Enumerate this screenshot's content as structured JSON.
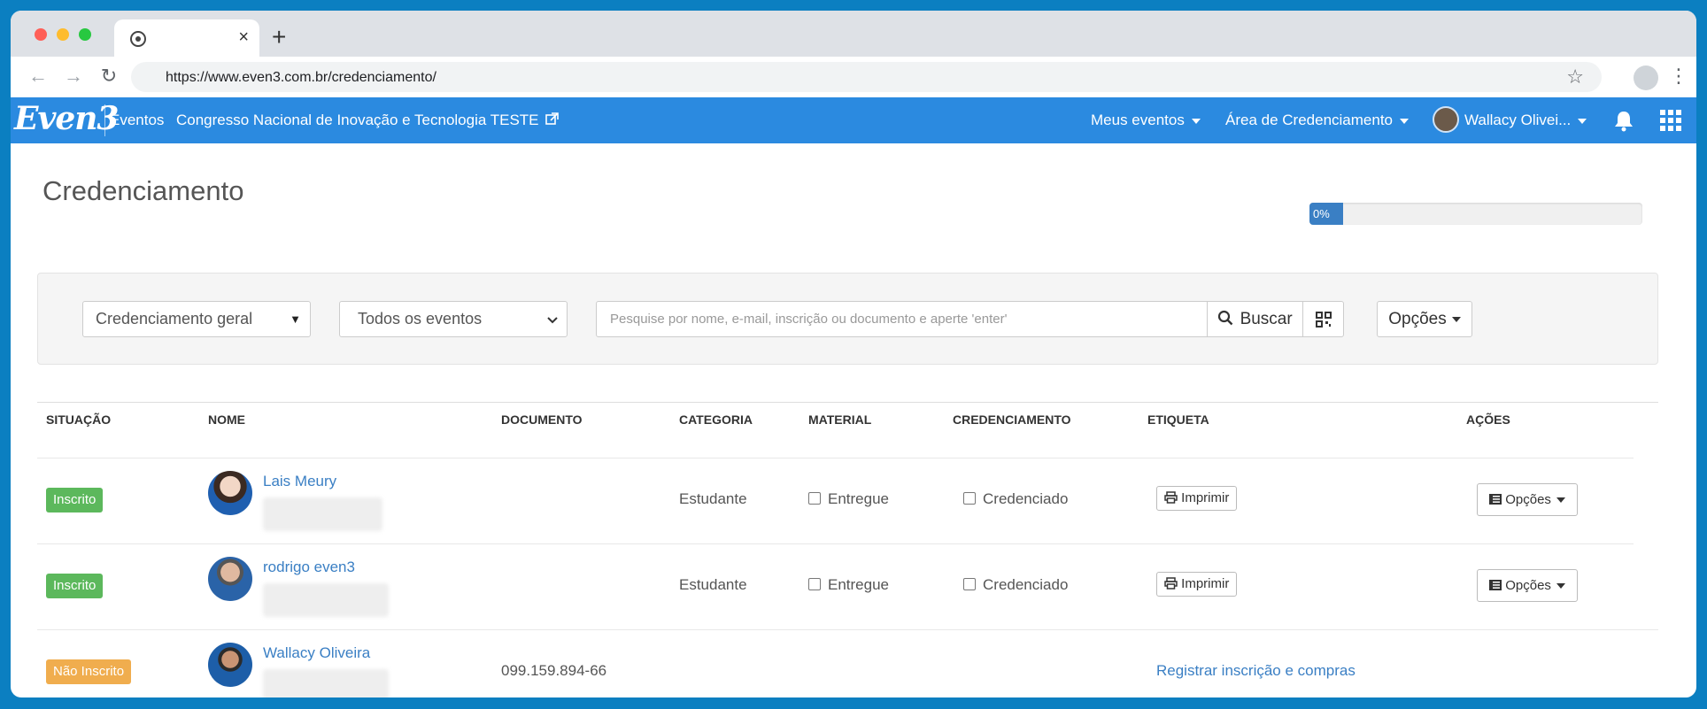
{
  "browser": {
    "tab_close": "×",
    "new_tab": "+",
    "url": "https://www.even3.com.br/credenciamento/"
  },
  "appbar": {
    "logo": "Even3",
    "eventos": "Eventos",
    "event_title": "Congresso Nacional de Inovação e Tecnologia TESTE",
    "meus_eventos": "Meus eventos",
    "area_credenciamento": "Área de Credenciamento",
    "user_name": "Wallacy Olivei..."
  },
  "page": {
    "title": "Credenciamento",
    "progress_label": "0%",
    "progress_value": 0.1
  },
  "filters": {
    "credenciamento_select": "Credenciamento geral",
    "eventos_select": "Todos os eventos",
    "search_placeholder": "Pesquise por nome, e-mail, inscrição ou documento e aperte 'enter'",
    "search_button": "Buscar",
    "options_button": "Opções"
  },
  "table": {
    "headers": [
      "SITUAÇÃO",
      "NOME",
      "DOCUMENTO",
      "CATEGORIA",
      "MATERIAL",
      "CREDENCIAMENTO",
      "ETIQUETA",
      "AÇÕES"
    ],
    "rows": [
      {
        "status": "Inscrito",
        "name": "Lais Meury",
        "documento": "",
        "categoria": "Estudante",
        "material": "Entregue",
        "credenciamento": "Credenciado",
        "etiqueta": "Imprimir",
        "acoes": "Opções"
      },
      {
        "status": "Inscrito",
        "name": "rodrigo even3",
        "documento": "",
        "categoria": "Estudante",
        "material": "Entregue",
        "credenciamento": "Credenciado",
        "etiqueta": "Imprimir",
        "acoes": "Opções"
      },
      {
        "status": "Não Inscrito",
        "name": "Wallacy Oliveira",
        "documento": "099.159.894-66",
        "register_link": "Registrar inscrição e compras"
      }
    ]
  },
  "colors": {
    "brand_blue": "#2b8ae0",
    "link_blue": "#3a7fc4",
    "status_green": "#5cb85c",
    "status_orange": "#f0ad4e"
  },
  "icons": [
    "chrome-icon",
    "back-icon",
    "forward-icon",
    "reload-icon",
    "star-icon",
    "profile-icon",
    "kebab-icon",
    "external-link-icon",
    "bell-icon",
    "apps-grid-icon",
    "search-icon",
    "qrcode-icon",
    "print-icon",
    "list-icon"
  ]
}
